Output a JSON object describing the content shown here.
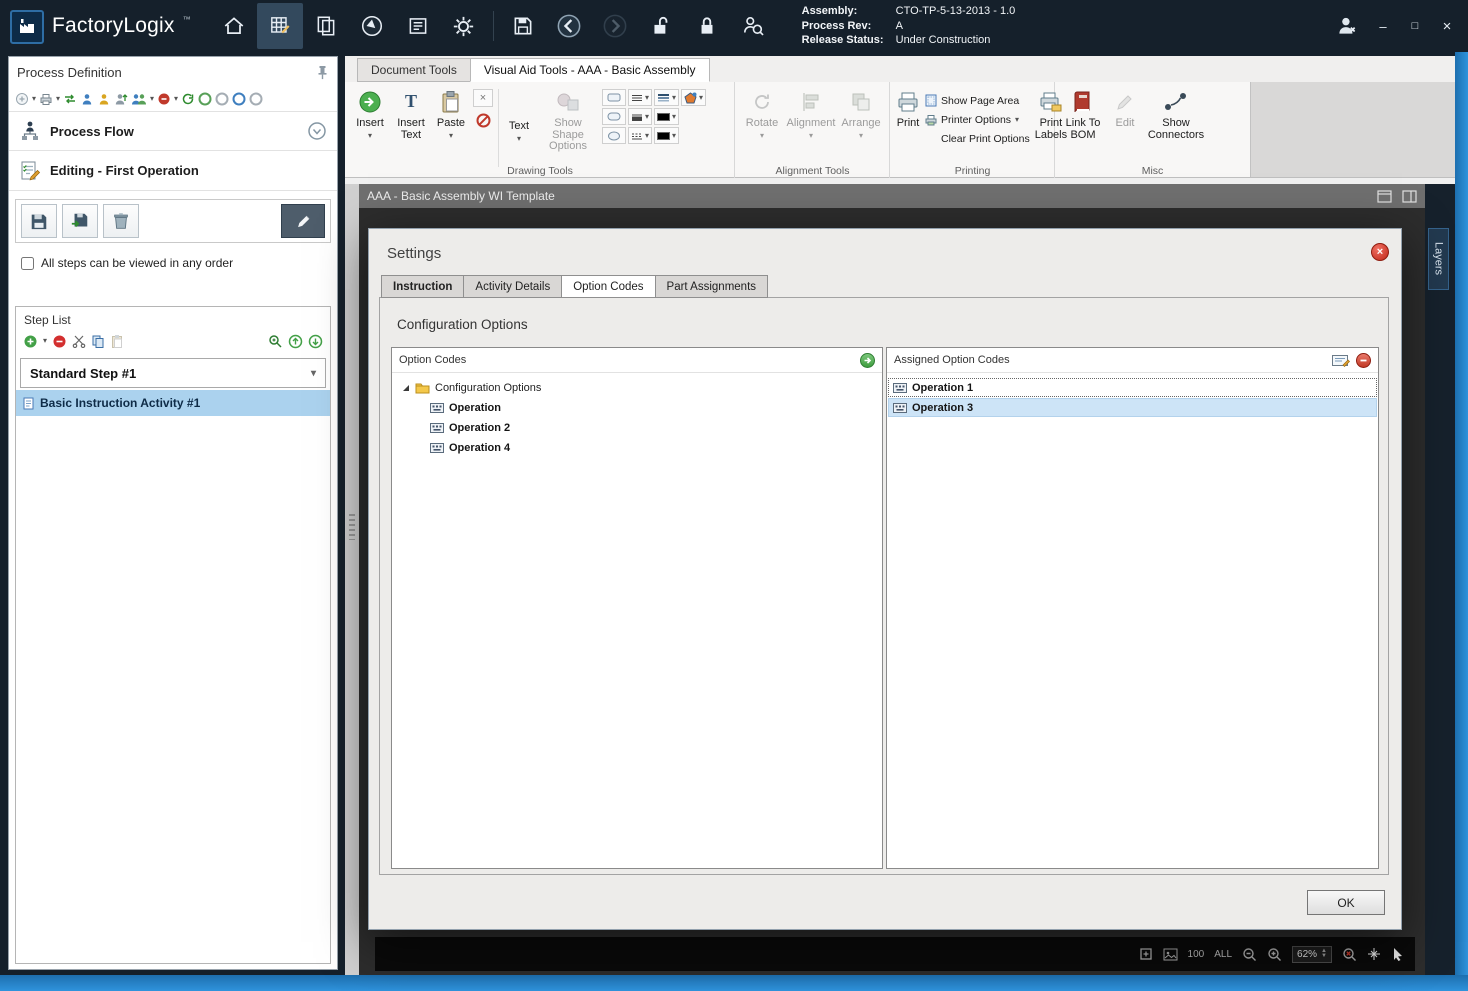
{
  "colors": {
    "titlebar_bg": "#15202b",
    "window_border": "#2f93dc",
    "selection_blue": "#abd2ee",
    "dialog_close_red": "#c02718",
    "accent_green": "#3f9d3f",
    "canvas_bg": "#2d2d2d"
  },
  "titlebar": {
    "app_name": "FactoryLogix",
    "trademark": "™",
    "info": {
      "assembly_label": "Assembly:",
      "assembly_value": "CTO-TP-5-13-2013 - 1.0",
      "process_rev_label": "Process Rev:",
      "process_rev_value": "A",
      "release_status_label": "Release Status:",
      "release_status_value": "Under Construction"
    }
  },
  "sidebar": {
    "title": "Process Definition",
    "process_flow_label": "Process Flow",
    "editing_label": "Editing - First Operation",
    "order_checkbox_label": "All steps can be viewed in any order",
    "step_list": {
      "title": "Step List",
      "step_name": "Standard Step #1",
      "activity_name": "Basic Instruction Activity #1"
    }
  },
  "main": {
    "tabs": {
      "document_tools": "Document Tools",
      "visual_aid_tools": "Visual Aid Tools - AAA - Basic Assembly"
    },
    "ribbon": {
      "insert": "Insert",
      "insert_text": "Insert Text",
      "paste": "Paste",
      "text": "Text",
      "show_shape_options": "Show Shape Options",
      "rotate": "Rotate",
      "alignment": "Alignment",
      "arrange": "Arrange",
      "print": "Print",
      "show_page_area": "Show Page Area",
      "printer_options": "Printer Options",
      "clear_print_options": "Clear Print Options",
      "print_labels": "Print Labels",
      "link_to_bom": "Link To BOM",
      "edit": "Edit",
      "show_connectors": "Show Connectors",
      "groups": {
        "drawing_tools": "Drawing Tools",
        "alignment_tools": "Alignment Tools",
        "printing": "Printing",
        "misc": "Misc"
      }
    },
    "document_title": "AAA - Basic Assembly WI Template",
    "layers_tab": "Layers",
    "statusbar": {
      "preset_100": "100",
      "preset_all": "ALL",
      "zoom_value": "62%"
    }
  },
  "dialog": {
    "title": "Settings",
    "tabs": {
      "instruction": "Instruction",
      "activity_details": "Activity Details",
      "option_codes": "Option Codes",
      "part_assignments": "Part Assignments"
    },
    "heading": "Configuration Options",
    "option_codes_panel": {
      "title": "Option Codes",
      "root": "Configuration Options",
      "items": [
        "Operation",
        "Operation 2",
        "Operation 4"
      ]
    },
    "assigned_panel": {
      "title": "Assigned Option Codes",
      "items": [
        "Operation 1",
        "Operation 3"
      ]
    },
    "ok_label": "OK"
  }
}
